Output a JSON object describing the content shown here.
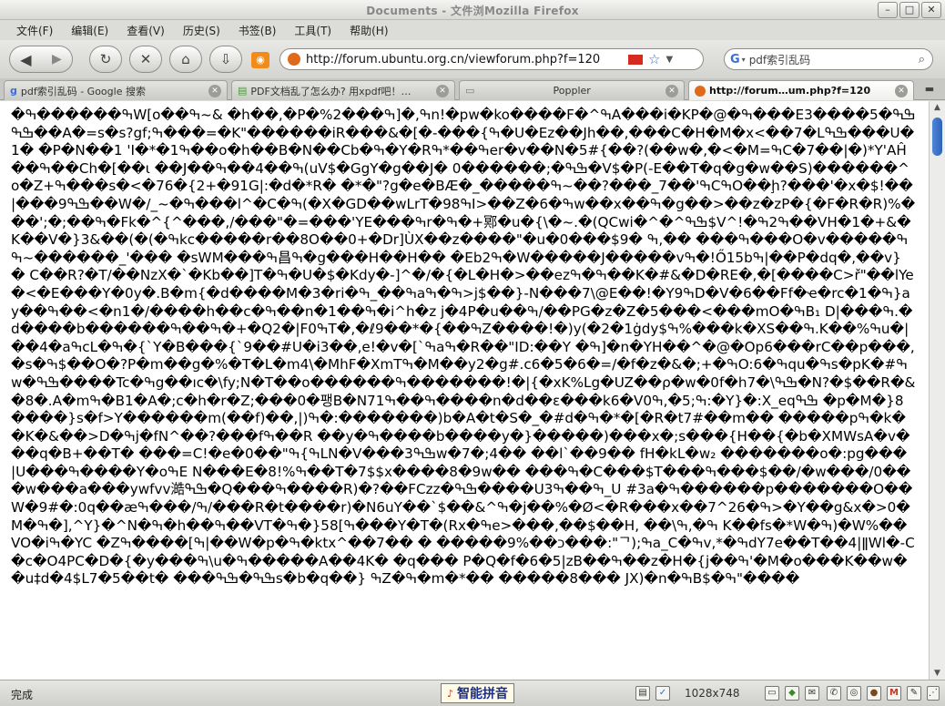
{
  "window": {
    "title": "Documents - 文件浏览 - Mozilla Firefox",
    "title_short": "Documents  -  文件浏Mozilla  Firefox"
  },
  "menu": [
    "文件(F)",
    "编辑(E)",
    "查看(V)",
    "历史(S)",
    "书签(B)",
    "工具(T)",
    "帮助(H)"
  ],
  "nav": {
    "url": "http://forum.ubuntu.org.cn/viewforum.php?f=120",
    "search_value": "pdf索引乱码"
  },
  "tabs": [
    {
      "label": "pdf索引乱码 - Google 搜索"
    },
    {
      "label": "PDF文档乱了怎么办? 用xpdf吧！…"
    },
    {
      "label": "Poppler"
    },
    {
      "label": "http://forum…um.php?f=120"
    }
  ],
  "content": {
    "garbled_text": "�ߒ������ߒW[o��ߒ~& �h��,�P�ߒ���%2]�,ߒn!�pw�ko����F�^ߒA���i�KP�@�ߒ���Eߒߒ�5����3��ߒߒA�=s�s?gf;ߒ���=�K\"������iR���&�[�-���{ߒ�U�Ez��Jh��,���C�H�M�x<��7�Lߒߒ���U�1� �P�N��1 'I�*�ߒ1��o�h��B�N��Cb�ߒ�Y�Rߒ��*ߒer�v��N�5#{��?(��w�,�<�M=ߒC�7��|�)*Y'AĤ��ߒ��Ch�[��ι ��J��ߒ��4��ߒ(uV$�GgY�g��J� ߒߒ�;������0�V$�P(-E��T�q�g�w��S)������^o�Z+ߒ���s�<�76�{2+�91G|:�d�*R� �*�\"?g�e�BÆ�_�����ߒ'��7_���?��~ߒCߒO��ḩ?���'�x�$!��|���ߒߒ9��W�/_~�ߒ���ⅼ^�C�ߒ(�X�GD��wLrT�98ߒI>��Z�ߒ�6w��x��ߒ�g��>��z�zP�{�F�R�R)%���';�;��ߒ�Fk�^{^���,/���\"�=���'YE���ߒr�ߒ�+鄍�u�{\\�~.�(QCwi�^�^ߒߒ$V^!�ߒ2ߒ��VH�1�+&�K��V�}3&��(�(�ߒkc�����r��8O��0+�Dr]ÙX��z����\"�u�0���$9� ߒ��� ��,ߒ���O�v�ߒ����ߒ~������_'��� �sWM���ߒ昌ߒ�g���H��H�� �Ebߒ2�W�����J�����vߒ�!Ő15bߒ|��P�dq�,��v} � C��R?�T/��NzX�`�Kb��]T�ߒ�U�$�Kdy�-]^�/�{�L�H�>��ezߒ�ߒ��K�#&�D�RE�,�[����C>ř\"��lYe�<�E���Y�0y�.B�m{�d����M�3�ri�ߒ��_ߒaߒ�ߒ>j$��}-N���7\\@E��!�Y9ߒD�V�6��Ff�ҽ�rc�ߒ�1}ay��ߒ��<�n1�/����h��c�ߒ��n�1��ߒ�i^h�z j�4P�u��ߒ/��PG�z�Z�5���<���mO�ߒB₁ D|���ߒ.�d����b������ߒ��ߒ�+�Q2�|F0ߒT�,�ℓ9��*�{��ߒZ����!�)y(�2�1ġdy$ߒ%���k�XS��ߒ.K��%ߒu�|��4�aߒcL�ߒ�{`Y�B���{`9��#U�i3��,e!�v�[`ߒaߒ�R��\"ID:��Y �ߒ]�n�YH��^�@�Op6���rC��p���,�s�ߒ$��O�?P�m��g�%�T�L�m4\\�MhF�XmTߒ�M��y2�g#.c6�5�6�=/�f�z�&�;+�ߒO:ߒ�6qu�ߒs�pK�#ߒw�ߒߒ����Tc�ߒg��ıc�\\fy;N�T��o������ߒ�������!�|{�xK%Lg�UZ��ρ�w�0f�hߒߒ\\�7�N?�$��R�&�8�.A�mߒ�B1�A�;c�h�r�Z;���0�팽B�N7ߒ��ߒ1����n�d��ɛ���k6�Vߒ;5�,ߒ0:�Y}�:X_eqߒߒ �p�M�}8����}s�f>Y������m(��f)��,|)ߒ�:�������)b�A�t�S�_�#d�ߒ�*�[�R�t7#��m��  �����pߒ�k��K�&��>D�ߒj�fN^��?���fߒ��R ��y�ߒ����b����y�}�����)���x�;s���{H��{�b�XMWsA�v���q�B+��T� ���=C!�e�0��\"ߒ{ߒLN�V���ߒߒ3w�7�;4�� ��l`��9�� fH�kL�w₂ �������o�:pg��� |U���ߒ����Y�oߒE N���E�ߒ%!8��T�7$$x����8�9w�� ���ߒ�C���$T���ߒ���$��/�w���/0���w���a���ywfvv澔ߒߒ�Q���ߒ����R)�?��FCzz�ߒߒ����U3ߒ��ߒ_U #3a�ߒ������p�������O��W�9#�:0q��æߒ/���ߒ/���R�t����r)�N6uY��`$��&^ߒ�j��%�Ø<�R���x��7^2ߒ�6>�Y��g&x�>0�M�ߒ�],^Y}�^N�ߒ�h��ߒ��VT�ߒ�}ߒ]58���Y�T�(Rx�ߒe>���,��$��H, ��\\ߒ�,ߒ K��fs�*W�ߒ)�W%��VO�iߒ�YC �Zߒ]����ߒ|��W�p�ߒ�ktx^��7�� � �����9%��כ���:\"ᄀ);ߒa_C�ߒv,*�ߒdY7e��T��4|ǁWl�-C�c�O4PC�D�{�y���ߒ\\u�ߒ�����A��4K� �q��� P�Q�f�6�5|zB��ߒ��z�H�{j��ߒ'�M�o���K��w��u‡d�4$L7�5��t� ���ߒߒ�ߒߒs�b�q��} ߒZ�ߒ�m�*�� �����8��� JX)�n�ߒB$�ߒ\"����"
  },
  "status": {
    "text": "完成",
    "ime_label": "智能拼音",
    "resolution": "1028x748"
  }
}
